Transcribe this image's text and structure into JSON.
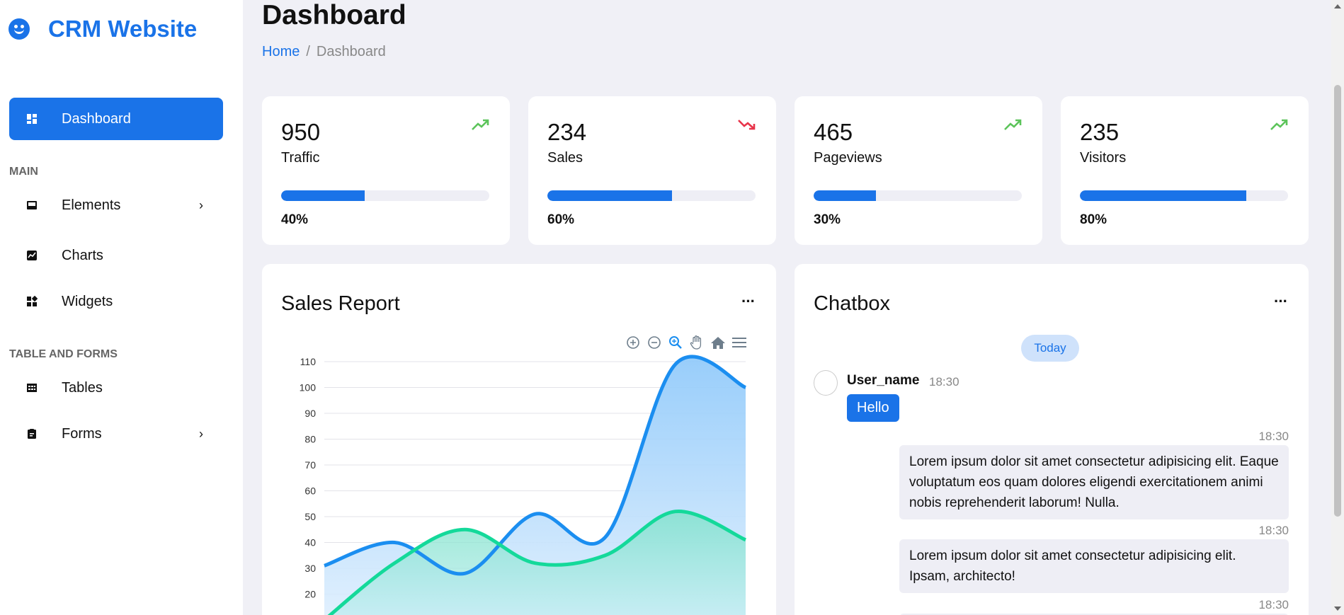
{
  "brand": {
    "name": "CRM Website"
  },
  "sidebar": {
    "items": [
      {
        "label": "Dashboard",
        "icon": "dashboard-icon",
        "active": true
      },
      {
        "label": "Elements",
        "icon": "inbox-icon",
        "chevron": true
      },
      {
        "label": "Charts",
        "icon": "chart-icon"
      },
      {
        "label": "Widgets",
        "icon": "widgets-icon"
      },
      {
        "label": "Tables",
        "icon": "table-icon"
      },
      {
        "label": "Forms",
        "icon": "clipboard-icon",
        "chevron": true
      }
    ],
    "sections": [
      "MAIN",
      "TABLE AND FORMS"
    ],
    "chevron": "›"
  },
  "header": {
    "title": "Dashboard",
    "breadcrumb": {
      "home": "Home",
      "separator": "/",
      "current": "Dashboard"
    }
  },
  "stats": [
    {
      "value": "950",
      "label": "Traffic",
      "percent": "40%",
      "progress": 0.4,
      "trend": "up"
    },
    {
      "value": "234",
      "label": "Sales",
      "percent": "60%",
      "progress": 0.6,
      "trend": "down"
    },
    {
      "value": "465",
      "label": "Pageviews",
      "percent": "30%",
      "progress": 0.3,
      "trend": "up"
    },
    {
      "value": "235",
      "label": "Visitors",
      "percent": "80%",
      "progress": 0.8,
      "trend": "up"
    }
  ],
  "colors": {
    "accent": "#1a73e8",
    "trend_up": "#5cc45a",
    "trend_down": "#e8344a",
    "series1": "#1b8ef0",
    "series2": "#14d99a"
  },
  "sales_report": {
    "title": "Sales Report",
    "menu": "···"
  },
  "chart_data": {
    "type": "area",
    "title": "Sales Report",
    "yticks": [
      20,
      30,
      40,
      50,
      60,
      70,
      80,
      90,
      100,
      110
    ],
    "ylim": [
      10,
      110
    ],
    "grid": true,
    "series": [
      {
        "values": [
          31,
          40,
          28,
          51,
          42,
          109,
          100
        ]
      },
      {
        "values": [
          10,
          32,
          45,
          32,
          35,
          52,
          41
        ]
      }
    ]
  },
  "chatbox": {
    "title": "Chatbox",
    "menu": "···",
    "day_label": "Today",
    "user": {
      "name": "User_name",
      "time": "18:30",
      "message": "Hello"
    },
    "replies": [
      {
        "time": "18:30",
        "text": "Lorem ipsum dolor sit amet consectetur adipisicing elit. Eaque voluptatum eos quam dolores eligendi exercitationem animi nobis reprehenderit laborum! Nulla."
      },
      {
        "time": "18:30",
        "text": "Lorem ipsum dolor sit amet consectetur adipisicing elit. Ipsam, architecto!"
      },
      {
        "time": "18:30",
        "text": ""
      }
    ]
  }
}
